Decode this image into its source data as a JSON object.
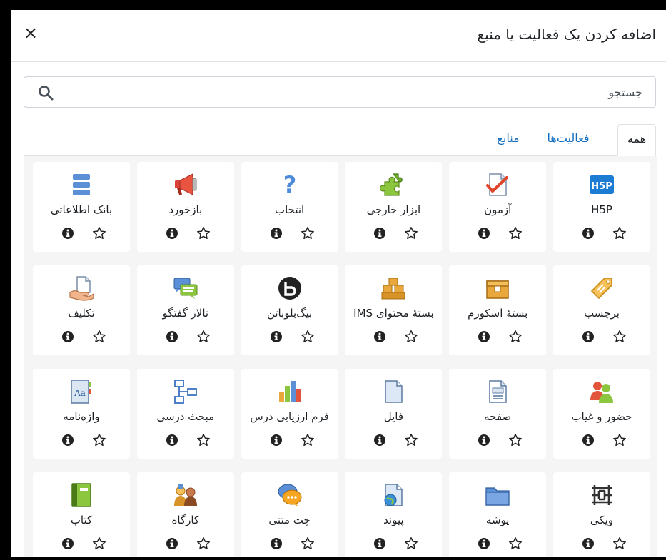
{
  "dialog": {
    "title": "اضافه کردن یک فعالیت یا منبع",
    "close_label": "×"
  },
  "search": {
    "text": "جستجو"
  },
  "tabs": [
    {
      "label": "همه",
      "active": true
    },
    {
      "label": "فعالیت‌ها",
      "active": false
    },
    {
      "label": "منابع",
      "active": false
    }
  ],
  "colors": {
    "link": "#0f6cbf",
    "border": "#dee2e6",
    "grid_bg": "#f5f5f5"
  },
  "modules": [
    {
      "name": "H5P",
      "icon": "h5p-icon"
    },
    {
      "name": "آزمون",
      "icon": "quiz-icon"
    },
    {
      "name": "ابزار خارجی",
      "icon": "puzzle-icon"
    },
    {
      "name": "انتخاب",
      "icon": "question-icon"
    },
    {
      "name": "بازخورد",
      "icon": "megaphone-icon"
    },
    {
      "name": "بانک اطلاعاتی",
      "icon": "database-icon"
    },
    {
      "name": "برچسب",
      "icon": "label-tag-icon"
    },
    {
      "name": "بستهٔ اسکورم",
      "icon": "package-box-icon"
    },
    {
      "name": "بستهٔ محتوای IMS",
      "icon": "stacked-boxes-icon"
    },
    {
      "name": "بیگ‌بلوباتن",
      "icon": "bigbluebutton-icon"
    },
    {
      "name": "تالار گفتگو",
      "icon": "forum-bubbles-icon"
    },
    {
      "name": "تکلیف",
      "icon": "assignment-hand-icon"
    },
    {
      "name": "حضور و غیاب",
      "icon": "attendance-people-icon"
    },
    {
      "name": "صفحه",
      "icon": "page-icon"
    },
    {
      "name": "فایل",
      "icon": "file-icon"
    },
    {
      "name": "فرم ارزیابی درس",
      "icon": "bar-chart-icon"
    },
    {
      "name": "مبحث درسی",
      "icon": "flowchart-icon"
    },
    {
      "name": "واژه‌نامه",
      "icon": "glossary-icon"
    },
    {
      "name": "ویکی",
      "icon": "wiki-icon"
    },
    {
      "name": "پوشه",
      "icon": "folder-icon"
    },
    {
      "name": "پیوند",
      "icon": "url-link-icon"
    },
    {
      "name": "چت متنی",
      "icon": "chat-icon"
    },
    {
      "name": "کارگاه",
      "icon": "workshop-people-icon"
    },
    {
      "name": "کتاب",
      "icon": "book-icon"
    }
  ]
}
